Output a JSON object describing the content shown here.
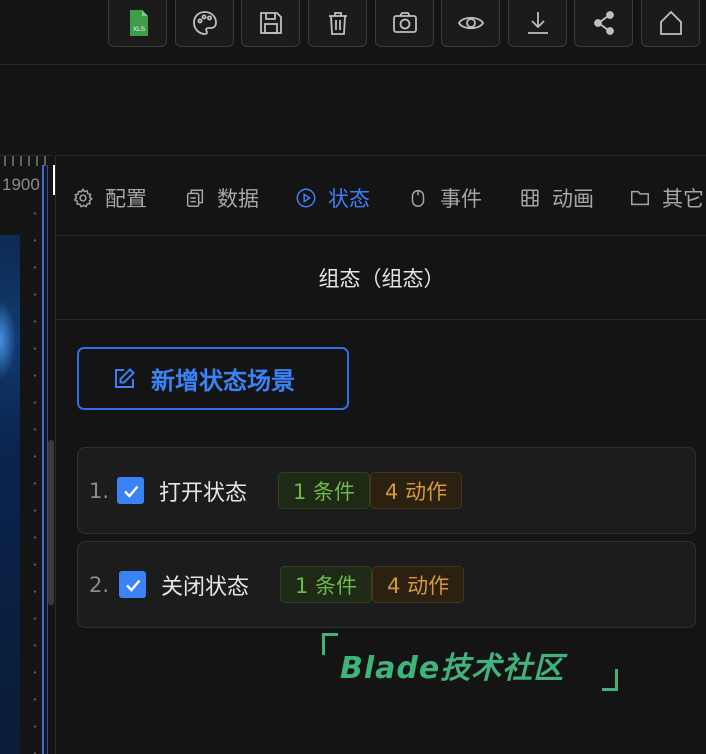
{
  "toolbar": {
    "buttons": [
      {
        "icon": "excel-file-icon",
        "badge": "XLS"
      },
      {
        "icon": "palette-icon"
      },
      {
        "icon": "save-icon"
      },
      {
        "icon": "trash-icon"
      },
      {
        "icon": "camera-icon"
      },
      {
        "icon": "eye-icon"
      },
      {
        "icon": "download-icon"
      },
      {
        "icon": "share-icon"
      },
      {
        "icon": "home-icon"
      }
    ]
  },
  "ruler": {
    "label": "1900"
  },
  "tabs": [
    {
      "label": "配置",
      "icon": "gear-icon",
      "active": false
    },
    {
      "label": "数据",
      "icon": "copy-icon",
      "active": false
    },
    {
      "label": "状态",
      "icon": "play-circle-icon",
      "active": true
    },
    {
      "label": "事件",
      "icon": "mouse-icon",
      "active": false
    },
    {
      "label": "动画",
      "icon": "film-icon",
      "active": false
    },
    {
      "label": "其它",
      "icon": "folder-icon",
      "active": false
    }
  ],
  "section": {
    "title": "组态（组态）"
  },
  "add_button": {
    "label": "新增状态场景"
  },
  "states": [
    {
      "index": "1.",
      "checked": true,
      "name": "打开状态",
      "conditions": "1 条件",
      "actions": "4 动作"
    },
    {
      "index": "2.",
      "checked": true,
      "name": "关闭状态",
      "conditions": "1 条件",
      "actions": "4 动作"
    }
  ],
  "watermark": {
    "text": "Blade技术社区"
  },
  "colors": {
    "background": "#141414",
    "accent": "#3b82f6",
    "condition_tag": "#6fb84a",
    "action_tag": "#d49a3a",
    "watermark": "#3fb37a"
  }
}
